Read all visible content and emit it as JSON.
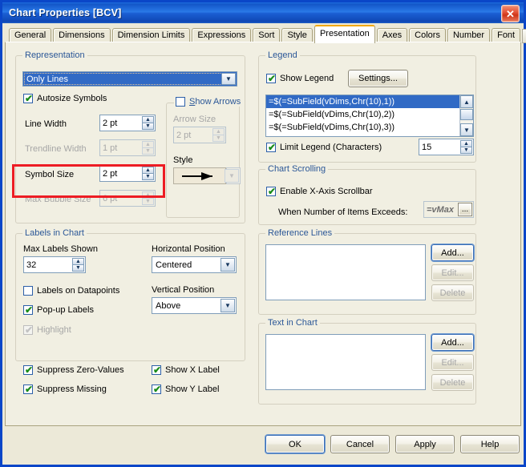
{
  "window": {
    "title": "Chart Properties [BCV]",
    "close_icon": "close-icon",
    "accent_blue": "#0a46c8",
    "face": "#ece9d8"
  },
  "tabs": {
    "items": [
      {
        "label": "General",
        "active": false
      },
      {
        "label": "Dimensions",
        "active": false
      },
      {
        "label": "Dimension Limits",
        "active": false
      },
      {
        "label": "Expressions",
        "active": false
      },
      {
        "label": "Sort",
        "active": false
      },
      {
        "label": "Style",
        "active": false
      },
      {
        "label": "Presentation",
        "active": true
      },
      {
        "label": "Axes",
        "active": false
      },
      {
        "label": "Colors",
        "active": false
      },
      {
        "label": "Number",
        "active": false
      },
      {
        "label": "Font",
        "active": false
      }
    ],
    "prev_icon": "chevron-left-icon",
    "next_icon": "chevron-right-icon"
  },
  "representation": {
    "group_label": "Representation",
    "combo_value": "Only Lines",
    "combo_icon": "chevron-down-icon",
    "autosize_symbols": {
      "label": "Autosize Symbols",
      "checked": true
    },
    "line_width": {
      "label": "Line Width",
      "value": "2 pt",
      "disabled": false
    },
    "trendline_width": {
      "label": "Trendline Width",
      "value": "1 pt",
      "disabled": true
    },
    "symbol_size": {
      "label": "Symbol Size",
      "value": "2 pt",
      "disabled": false
    },
    "max_bubble_size": {
      "label": "Max Bubble Size",
      "value": "6 pt",
      "disabled": true
    }
  },
  "show_arrows": {
    "label": "Show Arrows",
    "checked": false,
    "arrow_size": {
      "label": "Arrow Size",
      "value": "2 pt",
      "disabled": true
    },
    "style": {
      "label": "Style",
      "preview_icon": "arrow-right-icon",
      "disabled": true
    }
  },
  "labels_in_chart": {
    "group_label": "Labels in Chart",
    "max_labels_shown": {
      "label": "Max Labels Shown",
      "value": "32"
    },
    "horizontal_position": {
      "label": "Horizontal Position",
      "value": "Centered"
    },
    "vertical_position": {
      "label": "Vertical Position",
      "value": "Above"
    },
    "labels_on_datapoints": {
      "label": "Labels on Datapoints",
      "checked": false
    },
    "popup_labels": {
      "label": "Pop-up Labels",
      "checked": true
    },
    "highlight": {
      "label": "Highlight",
      "checked": true,
      "disabled": true
    }
  },
  "bottom_checks": {
    "suppress_zero_values": {
      "label": "Suppress Zero-Values",
      "checked": true
    },
    "suppress_missing": {
      "label": "Suppress Missing",
      "checked": true
    },
    "show_x_label": {
      "label": "Show X Label",
      "checked": true
    },
    "show_y_label": {
      "label": "Show Y Label",
      "checked": true
    }
  },
  "legend": {
    "group_label": "Legend",
    "show_legend": {
      "label": "Show Legend",
      "checked": true
    },
    "settings_button": "Settings...",
    "items": [
      "=$(=SubField(vDims,Chr(10),1))",
      "=$(=SubField(vDims,Chr(10),2))",
      "=$(=SubField(vDims,Chr(10),3))"
    ],
    "selected_index": 0,
    "limit_legend": {
      "label": "Limit Legend (Characters)",
      "checked": true,
      "value": "15"
    }
  },
  "chart_scrolling": {
    "group_label": "Chart Scrolling",
    "enable_x_axis_scrollbar": {
      "label": "Enable X-Axis Scrollbar",
      "checked": true
    },
    "items_exceeds": {
      "label": "When Number of Items Exceeds:",
      "value": "=vMax",
      "ellipsis_button": "..."
    }
  },
  "reference_lines": {
    "group_label": "Reference Lines",
    "items": [],
    "add_button": "Add...",
    "edit_button": "Edit...",
    "delete_button": "Delete"
  },
  "text_in_chart": {
    "group_label": "Text in Chart",
    "items": [],
    "add_button": "Add...",
    "edit_button": "Edit...",
    "delete_button": "Delete"
  },
  "footer": {
    "ok": "OK",
    "cancel": "Cancel",
    "apply": "Apply",
    "help": "Help"
  },
  "annotation": {
    "highlight_color": "#ed1c24"
  }
}
